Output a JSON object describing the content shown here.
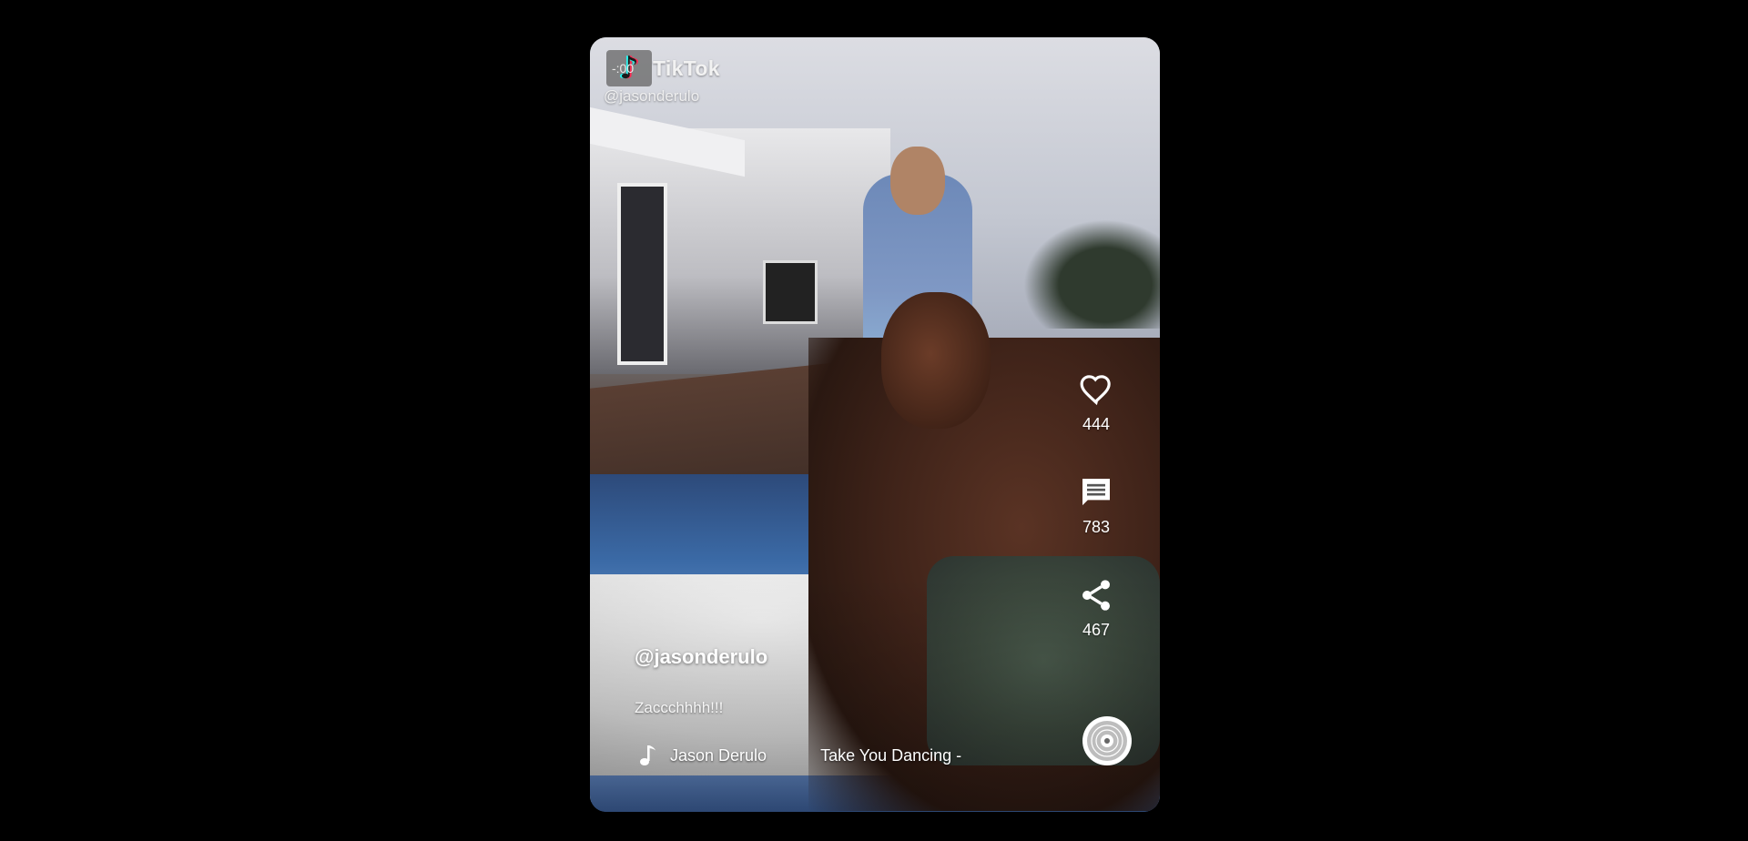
{
  "watermark": {
    "logo_icon": "tiktok-note-icon",
    "time": "-:00",
    "brand": "TikTok",
    "handle": "@jasonderulo"
  },
  "actions": {
    "like": {
      "icon": "heart-icon",
      "count": "444"
    },
    "comment": {
      "icon": "comment-icon",
      "count": "783"
    },
    "share": {
      "icon": "share-icon",
      "count": "467"
    }
  },
  "caption": {
    "author": "@jasonderulo",
    "description": "Zaccchhhh!!!"
  },
  "music": {
    "icon": "music-note-icon",
    "artist": "Jason Derulo",
    "title": "Take You Dancing -",
    "disc_icon": "music-disc-icon"
  },
  "colors": {
    "background": "#000000",
    "text": "#ffffff",
    "tiktok_cyan": "#25f4ee",
    "tiktok_red": "#fe2c55"
  }
}
